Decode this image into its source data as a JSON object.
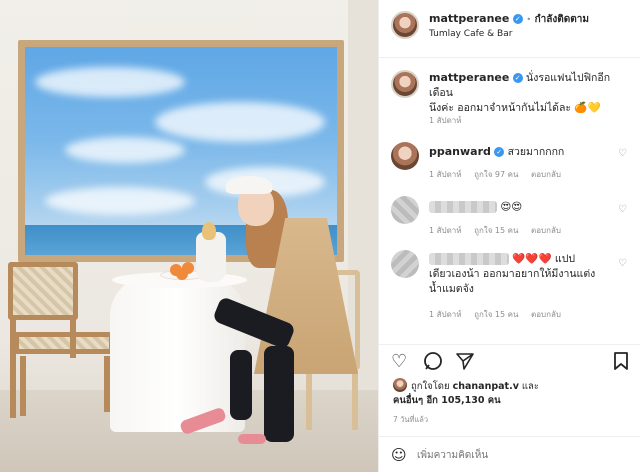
{
  "header": {
    "username": "mattperanee",
    "separator": "•",
    "follow_status": "กำลังติดตาม",
    "location": "Tumlay Cafe & Bar"
  },
  "caption": {
    "username": "mattperanee",
    "text_line1": "นั่งรอแฟนไปฟิกอีกเดือน",
    "text_line2": "นึงค่ะ ออกมาจำหน้ากันไม่ได้ละ",
    "emoji": "🍊💛",
    "time": "1 สัปดาห์"
  },
  "comments": [
    {
      "username": "ppanward",
      "text": "สวยมากกกก",
      "time": "1 สัปดาห์",
      "likes": "ถูกใจ 97 คน",
      "reply": "ตอบกลับ"
    },
    {
      "username": "",
      "text": "😍😍",
      "time": "1 สัปดาห์",
      "likes": "ถูกใจ 15 คน",
      "reply": "ตอบกลับ"
    },
    {
      "username": "",
      "text_hearts": "❤️❤️❤️",
      "text_line1": "แปป",
      "text_line2": "เดียวเองน้า ออกมาอยากให้มีงานแต่ง",
      "text_line3": "น้ำแมตจัง",
      "time": "1 สัปดาห์",
      "likes": "ถูกใจ 15 คน",
      "reply": "ตอบกลับ"
    }
  ],
  "actions": {
    "like_icon": "heart-icon",
    "comment_icon": "comment-icon",
    "share_icon": "paper-plane-icon",
    "save_icon": "bookmark-icon"
  },
  "likes_summary": {
    "liked_by_prefix": "ถูกใจโดย",
    "liked_by_user": "chananpat.v",
    "and": "และ",
    "others": "คนอื่นๆ อีก 105,130 คน"
  },
  "post_time": "7 วันที่แล้ว",
  "comment_input": {
    "placeholder": "เพิ่มความคิดเห็น",
    "emoji_icon": "smiley-icon"
  }
}
